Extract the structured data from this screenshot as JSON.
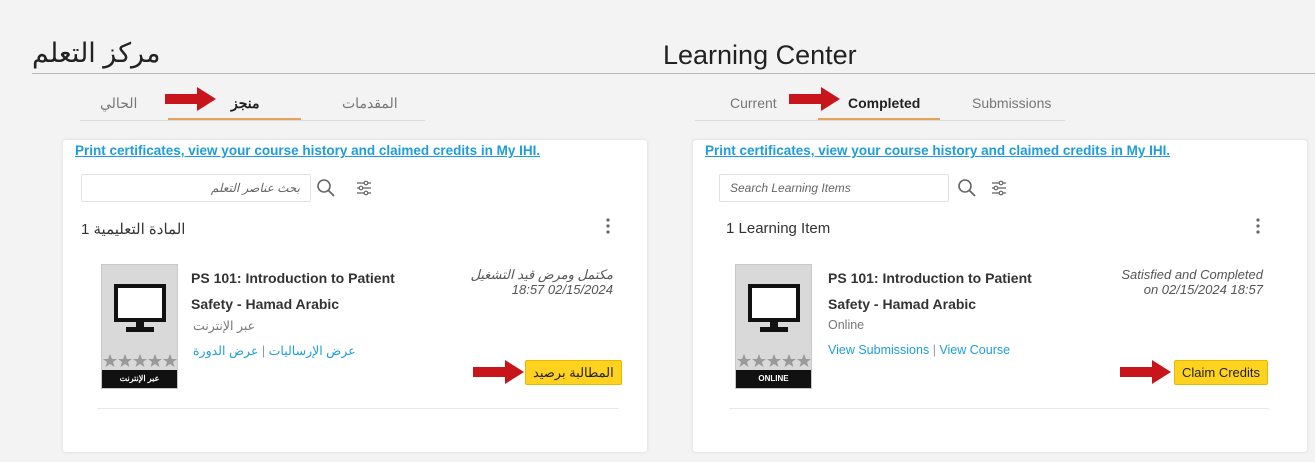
{
  "colors": {
    "link": "#1e9dd8",
    "claim_button": "#ffd21f",
    "tab_underline": "#e8a15a",
    "arrow": "#c8141b"
  },
  "arabic": {
    "title": "مركز التعلم",
    "tabs": {
      "current": "الحالي",
      "completed": "منجز",
      "submissions": "المقدمات"
    },
    "print_link": "Print certificates, view your course history and claimed credits in My IHI.",
    "search_placeholder": "بحث عناصر التعلم",
    "count_label": "المادة التعليمية 1",
    "course_title": "PS 101: Introduction to Patient Safety - Hamad Arabic",
    "delivery": "عبر الإنترنت",
    "view_submissions": "عرض الإرساليات",
    "separator": "|",
    "view_course": "عرض الدورة",
    "status": "مكتمل ومرض قيد التشغيل 02/15/2024 18:57",
    "claim_credits": "المطالبة برصيد",
    "thumb_badge": "عبر الإنترنت"
  },
  "english": {
    "title": "Learning Center",
    "tabs": {
      "current": "Current",
      "completed": "Completed",
      "submissions": "Submissions"
    },
    "print_link": "Print certificates, view your course history and claimed credits in My IHI.",
    "search_placeholder": "Search Learning Items",
    "count_label": "1 Learning Item",
    "course_title": "PS 101: Introduction to Patient Safety - Hamad Arabic",
    "delivery": "Online",
    "view_submissions": "View Submissions",
    "separator": "|",
    "view_course": "View Course",
    "status": "Satisfied and Completed on 02/15/2024 18:57",
    "claim_credits": "Claim Credits",
    "thumb_badge": "ONLINE"
  },
  "icons": {
    "search": "search-icon",
    "filter": "filter-icon",
    "more": "more-vertical-icon",
    "monitor": "monitor-icon",
    "star": "star-icon",
    "arrow": "arrow-right-icon"
  }
}
